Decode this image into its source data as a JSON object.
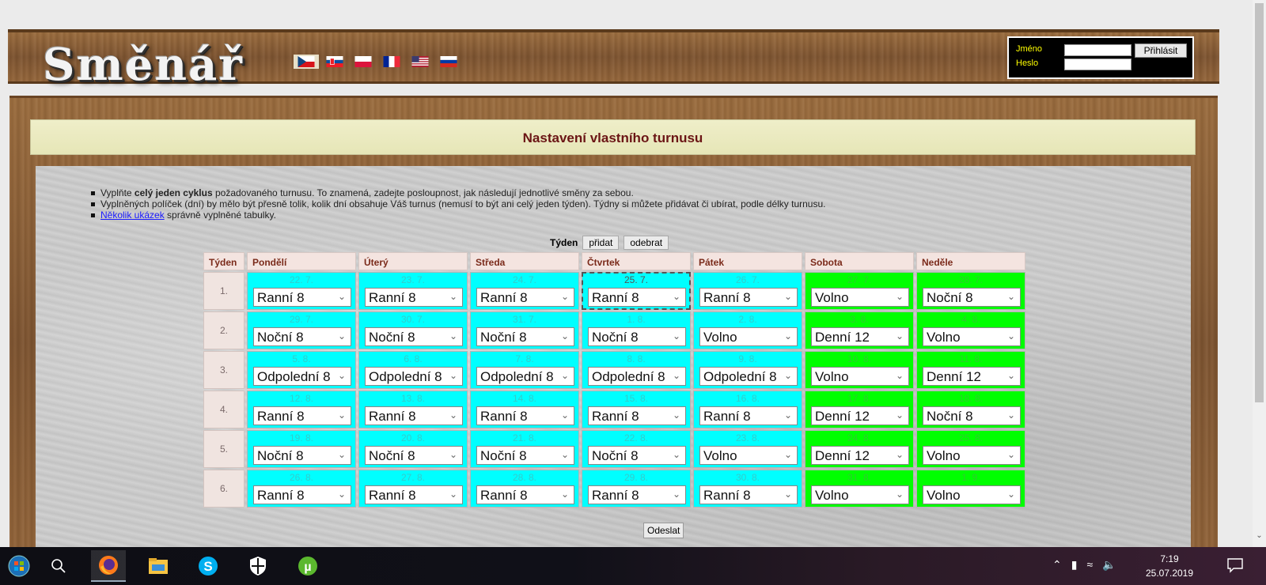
{
  "header": {
    "logo": "Směnář",
    "flags": [
      {
        "name": "czech-flag",
        "selected": true
      },
      {
        "name": "slovak-flag",
        "selected": false
      },
      {
        "name": "polish-flag",
        "selected": false
      },
      {
        "name": "french-flag",
        "selected": false
      },
      {
        "name": "us-flag",
        "selected": false
      },
      {
        "name": "russian-flag",
        "selected": false
      }
    ],
    "login": {
      "name_label": "Jméno",
      "password_label": "Heslo",
      "name_value": "",
      "password_value": "",
      "login_button": "Přihlásit"
    }
  },
  "page": {
    "title": "Nastavení vlastního turnusu",
    "instructions": {
      "line1_pre": "Vyplňte ",
      "line1_bold": "celý jeden cyklus",
      "line1_post": " požadovaného turnusu. To znamená, zadejte posloupnost, jak následují jednotlivé směny za sebou.",
      "line2": "Vyplněných políček (dní) by mělo být přesně tolik, kolik dní obsahuje Váš turnus (nemusí to být ani celý jeden týden). Týdny si můžete přidávat či ubírat, podle délky turnusu.",
      "line3_link": "Několik ukázek",
      "line3_post": " správně vyplněné tabulky."
    },
    "week_controls": {
      "label": "Týden",
      "add": "přidat",
      "remove": "odebrat"
    },
    "submit": "Odeslat"
  },
  "table": {
    "headers": [
      "Týden",
      "Pondělí",
      "Úterý",
      "Středa",
      "Čtvrtek",
      "Pátek",
      "Sobota",
      "Neděle"
    ],
    "rows": [
      {
        "week": "1.",
        "days": [
          {
            "date": "22. 7.",
            "shift": "Ranní 8"
          },
          {
            "date": "23. 7.",
            "shift": "Ranní 8"
          },
          {
            "date": "24. 7.",
            "shift": "Ranní 8"
          },
          {
            "date": "25. 7.",
            "shift": "Ranní 8"
          },
          {
            "date": "26. 7.",
            "shift": "Ranní 8"
          },
          {
            "date": "27. 7.",
            "shift": "Volno"
          },
          {
            "date": "28. 7.",
            "shift": "Noční 8"
          }
        ]
      },
      {
        "week": "2.",
        "days": [
          {
            "date": "29. 7.",
            "shift": "Noční 8"
          },
          {
            "date": "30. 7.",
            "shift": "Noční 8"
          },
          {
            "date": "31. 7.",
            "shift": "Noční 8"
          },
          {
            "date": "1. 8.",
            "shift": "Noční 8"
          },
          {
            "date": "2. 8.",
            "shift": "Volno"
          },
          {
            "date": "3. 8.",
            "shift": "Denní 12"
          },
          {
            "date": "4. 8.",
            "shift": "Volno"
          }
        ]
      },
      {
        "week": "3.",
        "days": [
          {
            "date": "5. 8.",
            "shift": "Odpolední 8"
          },
          {
            "date": "6. 8.",
            "shift": "Odpolední 8"
          },
          {
            "date": "7. 8.",
            "shift": "Odpolední 8"
          },
          {
            "date": "8. 8.",
            "shift": "Odpolední 8"
          },
          {
            "date": "9. 8.",
            "shift": "Odpolední 8"
          },
          {
            "date": "10. 8.",
            "shift": "Volno"
          },
          {
            "date": "11. 8.",
            "shift": "Denní 12"
          }
        ]
      },
      {
        "week": "4.",
        "days": [
          {
            "date": "12. 8.",
            "shift": "Ranní 8"
          },
          {
            "date": "13. 8.",
            "shift": "Ranní 8"
          },
          {
            "date": "14. 8.",
            "shift": "Ranní 8"
          },
          {
            "date": "15. 8.",
            "shift": "Ranní 8"
          },
          {
            "date": "16. 8.",
            "shift": "Ranní 8"
          },
          {
            "date": "17. 8.",
            "shift": "Denní 12"
          },
          {
            "date": "18. 8.",
            "shift": "Noční 8"
          }
        ]
      },
      {
        "week": "5.",
        "days": [
          {
            "date": "19. 8.",
            "shift": "Noční 8"
          },
          {
            "date": "20. 8.",
            "shift": "Noční 8"
          },
          {
            "date": "21. 8.",
            "shift": "Noční 8"
          },
          {
            "date": "22. 8.",
            "shift": "Noční 8"
          },
          {
            "date": "23. 8.",
            "shift": "Volno"
          },
          {
            "date": "24. 8.",
            "shift": "Denní 12"
          },
          {
            "date": "25. 8.",
            "shift": "Volno"
          }
        ]
      },
      {
        "week": "6.",
        "days": [
          {
            "date": "26. 8.",
            "shift": "Ranní 8"
          },
          {
            "date": "27. 8.",
            "shift": "Ranní 8"
          },
          {
            "date": "28. 8.",
            "shift": "Ranní 8"
          },
          {
            "date": "29. 8.",
            "shift": "Ranní 8"
          },
          {
            "date": "30. 8.",
            "shift": "Ranní 8"
          },
          {
            "date": "31. 8.",
            "shift": "Volno"
          },
          {
            "date": "1. 9.",
            "shift": "Volno"
          }
        ]
      }
    ],
    "colors": {
      "weekday": "#00ffff",
      "weekend": "#00ff00"
    }
  },
  "taskbar": {
    "icons": [
      "windows-start-icon",
      "search-icon",
      "firefox-icon",
      "file-explorer-icon",
      "skype-icon",
      "security-shield-icon",
      "utorrent-icon"
    ],
    "time": "7:19",
    "date": "25.07.2019"
  }
}
